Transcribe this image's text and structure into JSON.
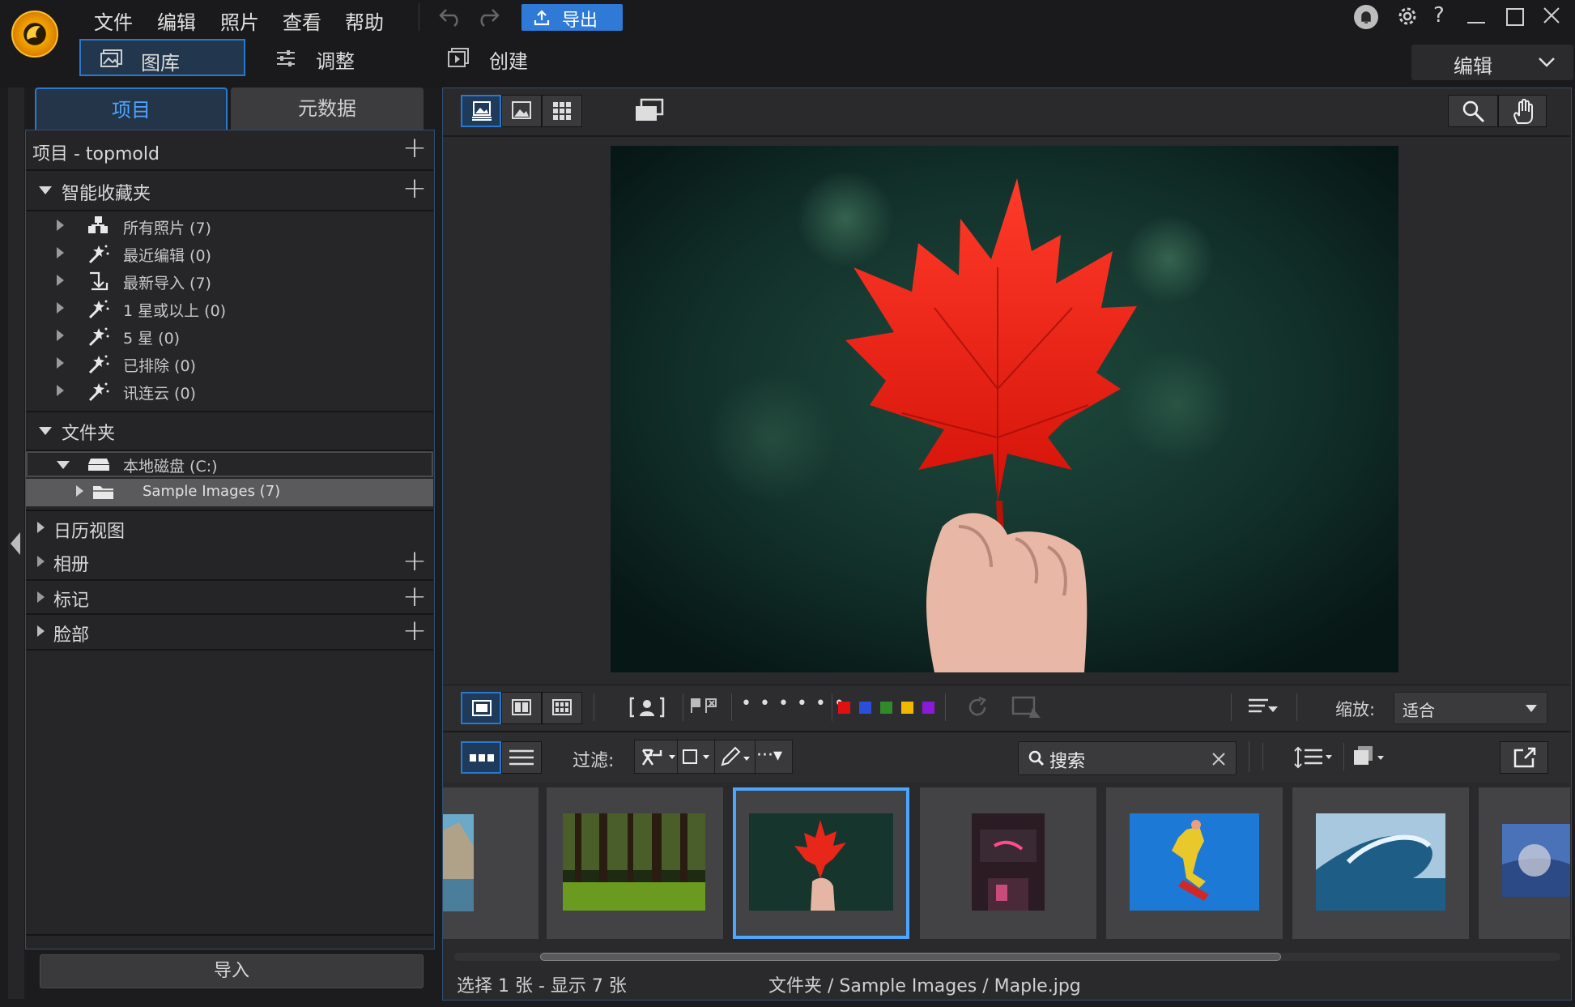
{
  "menu": {
    "file": "文件",
    "edit": "编辑",
    "photo": "照片",
    "view": "查看",
    "help": "帮助"
  },
  "export_label": "导出",
  "modes": {
    "library": "图库",
    "adjust": "调整",
    "create": "创建"
  },
  "edit_dropdown": "编辑",
  "panel_tabs": {
    "project": "项目",
    "metadata": "元数据"
  },
  "project_header": "项目 - topmold",
  "smart_folders": {
    "title": "智能收藏夹",
    "items": [
      {
        "label": "所有照片 (7)",
        "icon": "photos-icon"
      },
      {
        "label": "最近编辑 (0)",
        "icon": "magic-wand-icon"
      },
      {
        "label": "最新导入 (7)",
        "icon": "import-arrow-icon"
      },
      {
        "label": "1 星或以上 (0)",
        "icon": "magic-wand-icon"
      },
      {
        "label": "5 星 (0)",
        "icon": "magic-wand-icon"
      },
      {
        "label": "已排除 (0)",
        "icon": "magic-wand-icon"
      },
      {
        "label": "讯连云 (0)",
        "icon": "magic-wand-icon"
      }
    ]
  },
  "folders": {
    "title": "文件夹",
    "drive": "本地磁盘 (C:)",
    "sample": "Sample Images (7)"
  },
  "sections": {
    "calendar": "日历视图",
    "albums": "相册",
    "tags": "标记",
    "faces": "脸部"
  },
  "import_label": "导入",
  "zoom": {
    "label": "缩放:",
    "value": "适合"
  },
  "filter": {
    "label": "过滤:"
  },
  "search": {
    "placeholder": "搜索"
  },
  "colors": {
    "accent": "#2a78cc",
    "red": "#e01010",
    "blue": "#2a4fd8",
    "green": "#2f8a2a",
    "yellow": "#f0b800",
    "purple": "#8a1ad8"
  },
  "status": {
    "selection": "选择 1 张 - 显示 7 张",
    "path": "文件夹 / Sample Images / Maple.jpg"
  }
}
